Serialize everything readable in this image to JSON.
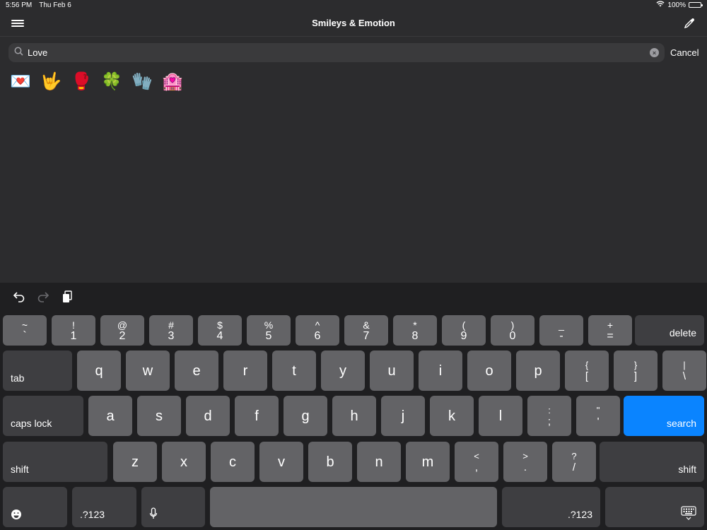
{
  "status": {
    "time": "5:56 PM",
    "date": "Thu Feb 6",
    "battery": "100%"
  },
  "nav": {
    "title": "Smileys & Emotion"
  },
  "search": {
    "value": "Love",
    "clear_glyph": "×",
    "cancel_label": "Cancel"
  },
  "results": [
    {
      "emoji": "💌",
      "icon": "love-letter-icon"
    },
    {
      "emoji": "🤟",
      "icon": "love-you-gesture-icon"
    },
    {
      "emoji": "🥊",
      "icon": "boxing-glove-icon"
    },
    {
      "emoji": "🍀",
      "icon": "four-leaf-clover-icon"
    },
    {
      "emoji": "🧤",
      "icon": "gloves-icon"
    },
    {
      "emoji": "🏩",
      "icon": "love-hotel-icon"
    }
  ],
  "keyboard": {
    "number_row": [
      {
        "top": "~",
        "bot": "`"
      },
      {
        "top": "!",
        "bot": "1"
      },
      {
        "top": "@",
        "bot": "2"
      },
      {
        "top": "#",
        "bot": "3"
      },
      {
        "top": "$",
        "bot": "4"
      },
      {
        "top": "%",
        "bot": "5"
      },
      {
        "top": "^",
        "bot": "6"
      },
      {
        "top": "&",
        "bot": "7"
      },
      {
        "top": "*",
        "bot": "8"
      },
      {
        "top": "(",
        "bot": "9"
      },
      {
        "top": ")",
        "bot": "0"
      },
      {
        "top": "_",
        "bot": "-"
      },
      {
        "top": "+",
        "bot": "="
      }
    ],
    "delete_label": "delete",
    "tab_label": "tab",
    "row_q": [
      "q",
      "w",
      "e",
      "r",
      "t",
      "y",
      "u",
      "i",
      "o",
      "p"
    ],
    "row_q_symbols": [
      {
        "top": "{",
        "bot": "["
      },
      {
        "top": "}",
        "bot": "]"
      },
      {
        "top": "|",
        "bot": "\\"
      }
    ],
    "caps_label": "caps lock",
    "row_a": [
      "a",
      "s",
      "d",
      "f",
      "g",
      "h",
      "j",
      "k",
      "l"
    ],
    "row_a_symbols": [
      {
        "top": ":",
        "bot": ";"
      },
      {
        "top": "\"",
        "bot": "'"
      }
    ],
    "search_label": "search",
    "shift_label": "shift",
    "row_z": [
      "z",
      "x",
      "c",
      "v",
      "b",
      "n",
      "m"
    ],
    "row_z_symbols": [
      {
        "top": "<",
        "bot": ","
      },
      {
        "top": ">",
        "bot": "."
      },
      {
        "top": "?",
        "bot": "/"
      }
    ],
    "numbers_label": ".?123"
  },
  "colors": {
    "accent": "#0a84ff",
    "key": "#636366",
    "key_dark": "#3e3e41",
    "background": "#2c2c2e"
  }
}
